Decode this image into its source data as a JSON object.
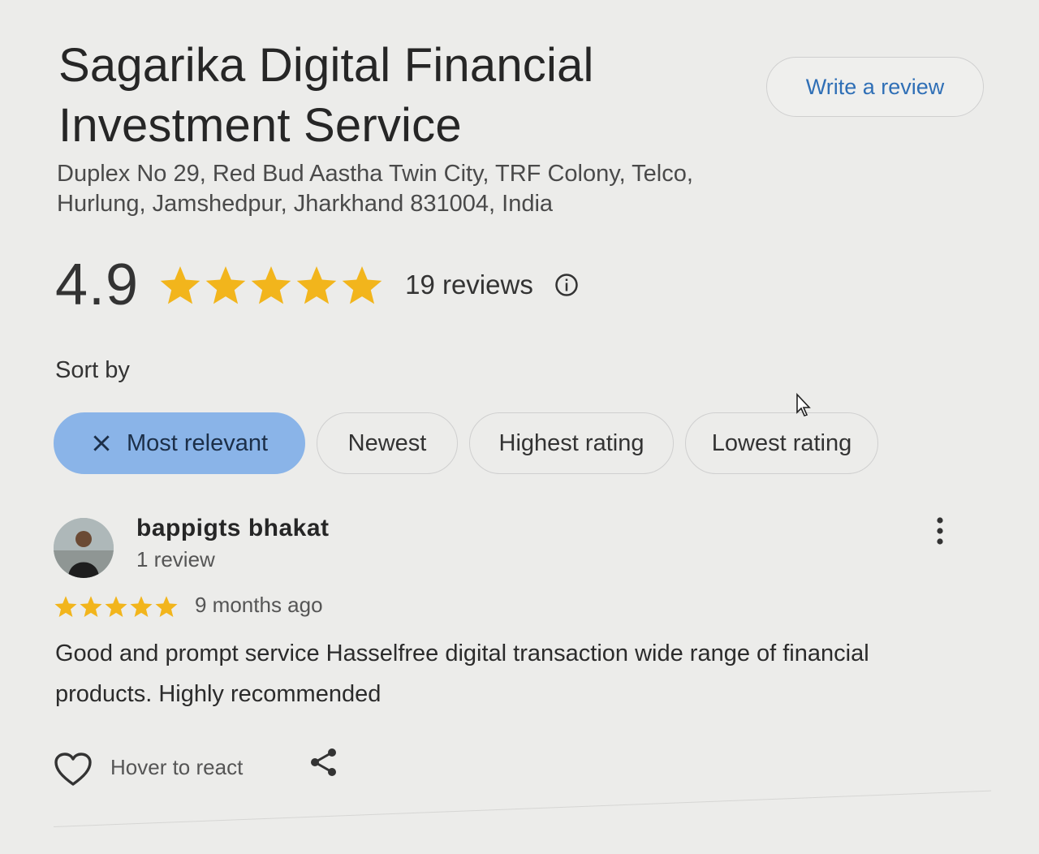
{
  "place": {
    "title_line1": "Sagarika Digital Financial",
    "title_line2": "Investment Service",
    "address_line1": "Duplex No 29, Red Bud Aastha Twin City, TRF Colony, Telco,",
    "address_line2": "Hurlung, Jamshedpur, Jharkhand 831004, India",
    "write_review_label": "Write a review"
  },
  "rating": {
    "value": "4.9",
    "stars": 5,
    "reviews_label": "19 reviews",
    "star_color": "#f2b51c"
  },
  "sort": {
    "label": "Sort by",
    "options": [
      {
        "label": "Most relevant",
        "selected": true
      },
      {
        "label": "Newest",
        "selected": false
      },
      {
        "label": "Highest rating",
        "selected": false
      },
      {
        "label": "Lowest rating",
        "selected": false
      }
    ],
    "selected_color": "#8ab4e8"
  },
  "review": {
    "author": "bappigts bhakat",
    "author_meta": "1 review",
    "stars": 5,
    "time": "9 months ago",
    "text_line1": "Good and prompt service Hasselfree digital transaction wide range of financial",
    "text_line2": "products. Highly recommended",
    "react_label": "Hover to react"
  },
  "icons": [
    "info-icon",
    "close-icon",
    "more-vert-icon",
    "heart-icon",
    "share-icon",
    "star-icon",
    "cursor-icon"
  ]
}
